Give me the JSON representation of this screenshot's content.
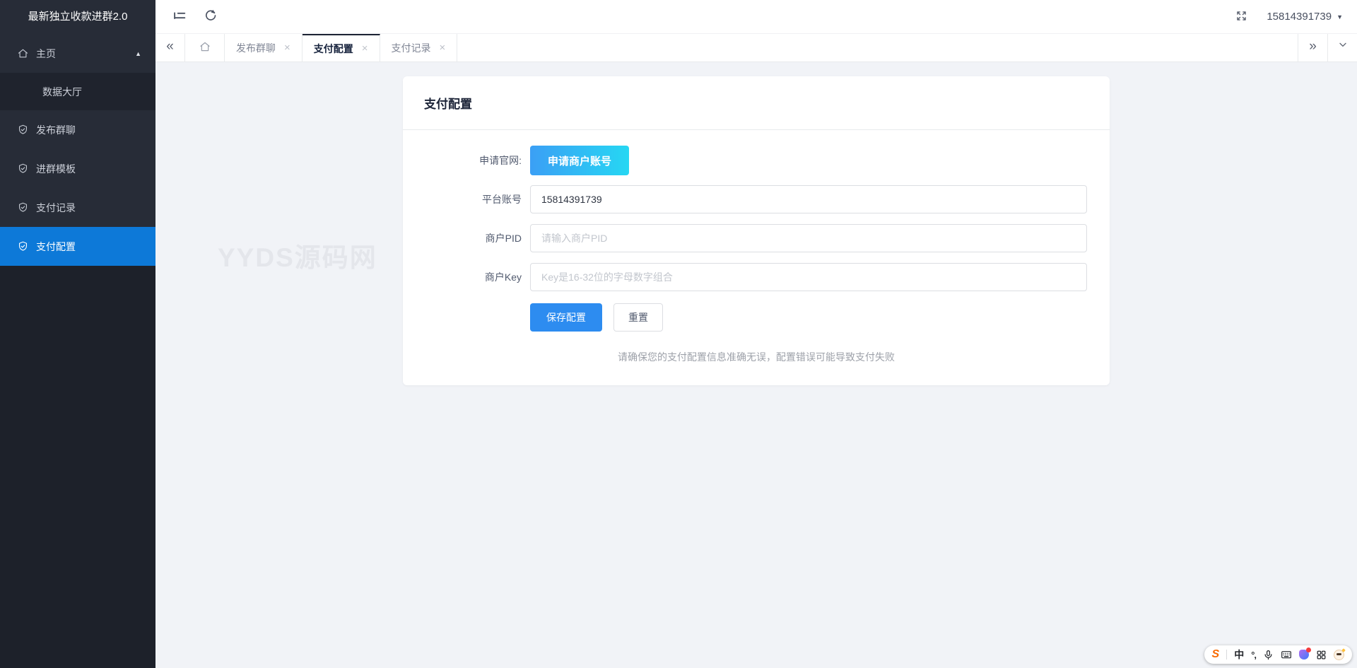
{
  "app": {
    "title": "最新独立收款进群2.0"
  },
  "header": {
    "account": "15814391739"
  },
  "sidebar": {
    "home": {
      "label": "主页"
    },
    "data_hall": {
      "label": "数据大厅"
    },
    "publish": {
      "label": "发布群聊"
    },
    "template": {
      "label": "进群模板"
    },
    "pay_records": {
      "label": "支付记录"
    },
    "pay_config": {
      "label": "支付配置"
    }
  },
  "tabs": {
    "publish": {
      "label": "发布群聊"
    },
    "pay_config": {
      "label": "支付配置"
    },
    "pay_records": {
      "label": "支付记录"
    }
  },
  "watermark": "YYDS源码网",
  "card": {
    "title": "支付配置",
    "form": {
      "website": {
        "label": "申请官网:",
        "button": "申请商户账号"
      },
      "account": {
        "label": "平台账号",
        "value": "15814391739"
      },
      "pid": {
        "label": "商户PID",
        "placeholder": "请输入商户PID"
      },
      "key": {
        "label": "商户Key",
        "placeholder": "Key是16-32位的字母数字组合"
      },
      "save": "保存配置",
      "reset": "重置"
    },
    "note": "请确保您的支付配置信息准确无误，配置错误可能导致支付失败"
  },
  "icons": {
    "caret_up": "▲",
    "caret_down": "▼",
    "collapse_left": "«",
    "collapse_right": "»",
    "close": "×",
    "sogou": "S",
    "ime_mode": "中",
    "ime_punct": "°,"
  },
  "colors": {
    "sidebar_active": "#0d79d8",
    "primary_button": "#2d8cf0",
    "gradient_start": "#3b9ff5",
    "gradient_end": "#26d7f3",
    "tab_active_border": "#1c2333"
  }
}
